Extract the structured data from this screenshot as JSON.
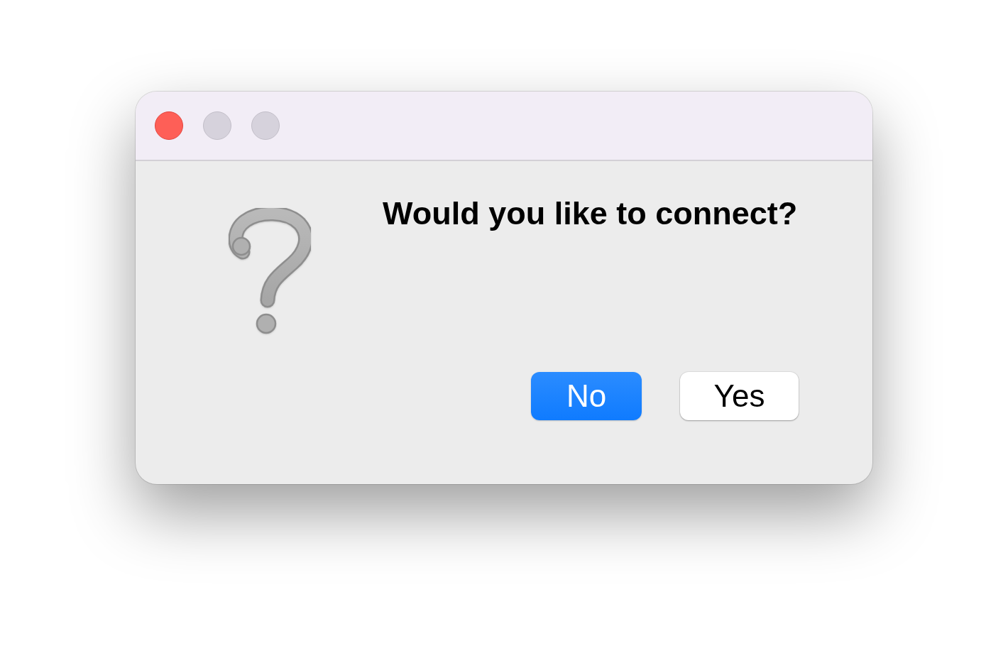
{
  "window": {
    "controls": [
      {
        "kind": "close",
        "disabled": false
      },
      {
        "kind": "minimize",
        "disabled": true
      },
      {
        "kind": "zoom",
        "disabled": true
      }
    ]
  },
  "dialog": {
    "message": "Would you like to connect?",
    "buttons": [
      {
        "label": "No",
        "default": true
      },
      {
        "label": "Yes",
        "default": false
      }
    ]
  }
}
